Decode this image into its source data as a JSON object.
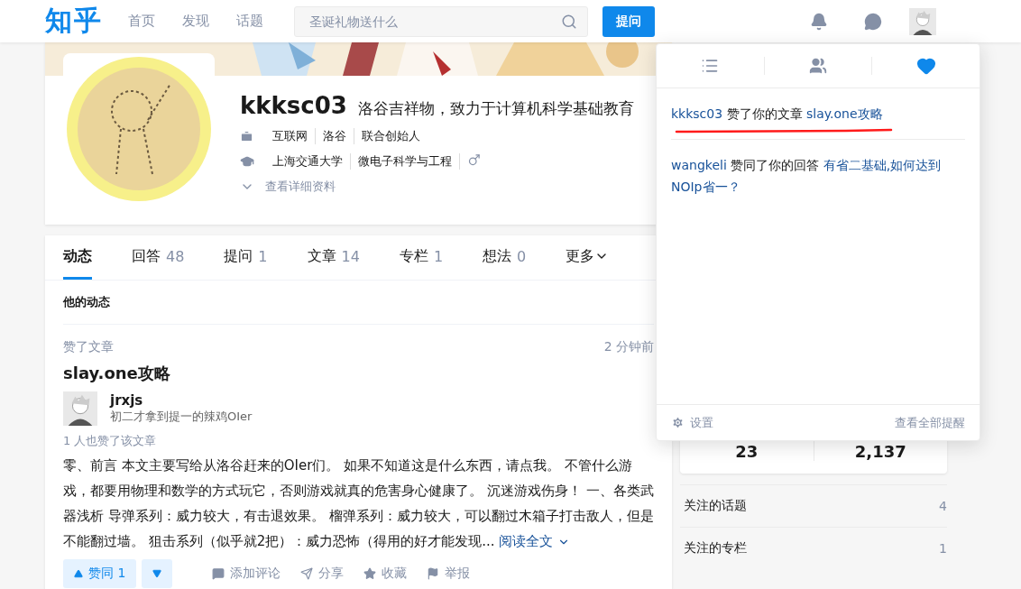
{
  "header": {
    "logo": "知乎",
    "nav": [
      {
        "label": "首页"
      },
      {
        "label": "发现"
      },
      {
        "label": "话题"
      }
    ],
    "search": {
      "placeholder": "圣诞礼物送什么"
    },
    "ask_button": "提问"
  },
  "profile": {
    "name": "kkksc03",
    "headline": "洛谷吉祥物，致力于计算机科学基础教育",
    "work": [
      "互联网",
      "洛谷",
      "联合创始人"
    ],
    "education": [
      "上海交通大学",
      "微电子科学与工程"
    ],
    "more_link": "查看详细资料"
  },
  "tabs": [
    {
      "label": "动态",
      "selected": true
    },
    {
      "label": "回答",
      "count": "48",
      "selected": false
    },
    {
      "label": "提问",
      "count": "1",
      "selected": false
    },
    {
      "label": "文章",
      "count": "14",
      "selected": false
    },
    {
      "label": "专栏",
      "count": "1",
      "selected": false
    },
    {
      "label": "想法",
      "count": "0",
      "selected": false
    },
    {
      "label": "更多",
      "selected": false,
      "kind": "dropdown"
    }
  ],
  "feed": {
    "heading": "他的动态",
    "items": [
      {
        "action": "赞了文章",
        "time": "2 分钟前",
        "title": "slay.one攻略",
        "author": {
          "name": "jrxjs",
          "bio": "初二才拿到提一的辣鸡OIer"
        },
        "likes_note": "1 人也赞了该文章",
        "excerpt": "零、前言 本文主要写给从洛谷赶来的OIer们。 如果不知道这是什么东西，请点我。 不管什么游戏，都要用物理和数学的方式玩它，否则游戏就真的危害身心健康了。 沉迷游戏伤身！ 一、各类武器浅析 导弹系列：威力较大，有击退效果。 榴弹系列：威力较大，可以翻过木箱子打击敌人，但是不能翻过墙。 狙击系列（似乎就2把）：威力恐怖（得用的好才能发现...",
        "read_more": "阅读全文",
        "actions": [
          {
            "kind": "upvote",
            "label": "赞同 1"
          },
          {
            "kind": "downvote"
          },
          {
            "kind": "comment",
            "label": "添加评论"
          },
          {
            "kind": "share",
            "label": "分享"
          },
          {
            "kind": "favorite",
            "label": "收藏"
          },
          {
            "kind": "report",
            "label": "举报"
          }
        ]
      }
    ]
  },
  "sidebar": {
    "stats": [
      "23",
      "2,137"
    ],
    "rows": [
      {
        "label": "关注的话题",
        "count": "4"
      },
      {
        "label": "关注的专栏",
        "count": "1"
      }
    ]
  },
  "notifications": {
    "tabs": [
      {
        "kind": "list",
        "selected": false
      },
      {
        "kind": "people",
        "selected": false
      },
      {
        "kind": "likes",
        "selected": true
      }
    ],
    "items": [
      {
        "user": "kkksc03",
        "action": "赞了你的文章",
        "target": "slay.one攻略",
        "marked": true
      },
      {
        "user": "wangkeli",
        "action": "赞同了你的回答",
        "target": "有省二基础,如何达到NOIp省一？",
        "marked": false
      }
    ],
    "settings": "设置",
    "view_all": "查看全部提醒"
  }
}
